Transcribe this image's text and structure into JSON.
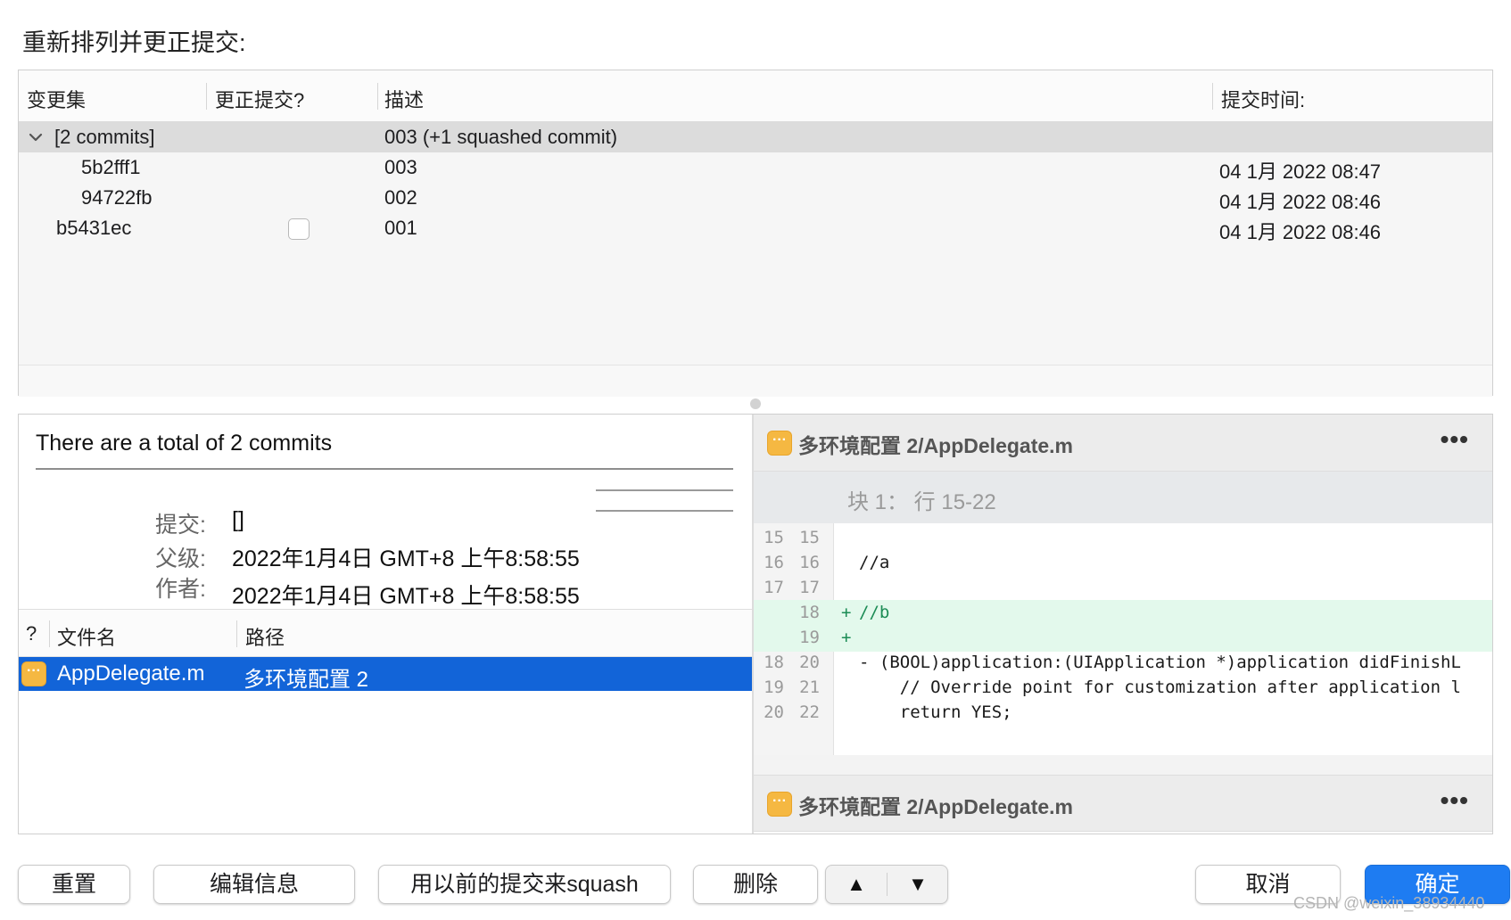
{
  "dialog": {
    "title": "重新排列并更正提交:"
  },
  "commit_table": {
    "columns": [
      "变更集",
      "更正提交?",
      "描述",
      "提交时间:"
    ],
    "group": {
      "label": "[2 commits]",
      "description": "003 (+1 squashed commit)"
    },
    "rows": [
      {
        "changeset": "5b2fff1",
        "description": "003",
        "time": "04 1月 2022 08:47"
      },
      {
        "changeset": "94722fb",
        "description": "002",
        "time": "04 1月 2022 08:46"
      },
      {
        "changeset": "b5431ec",
        "description": "001",
        "time": "04 1月 2022 08:46",
        "fixup_checked": false
      }
    ]
  },
  "commit_info": {
    "message": "There are a total of 2 commits",
    "meta": [
      {
        "label": "提交:",
        "value": "[]"
      },
      {
        "label": "父级:",
        "value": "2022年1月4日 GMT+8 上午8:58:55"
      },
      {
        "label": "作者:",
        "value": "2022年1月4日 GMT+8 上午8:58:55"
      }
    ]
  },
  "files": {
    "columns": [
      "?",
      "文件名",
      "路径"
    ],
    "rows": [
      {
        "name": "AppDelegate.m",
        "path": "多环境配置 2",
        "status_icon": "modified-file-icon",
        "selected": true
      }
    ]
  },
  "diff": {
    "file_path": "多环境配置 2/AppDelegate.m",
    "more_label": "•••",
    "hunk_title": "块 1： 行 15-22",
    "lines": [
      {
        "old": "15",
        "new": "15",
        "marker": "",
        "text": "",
        "type": "ctx"
      },
      {
        "old": "16",
        "new": "16",
        "marker": "",
        "text": "//a",
        "type": "ctx"
      },
      {
        "old": "17",
        "new": "17",
        "marker": "",
        "text": "",
        "type": "ctx"
      },
      {
        "old": "",
        "new": "18",
        "marker": "+",
        "text": "//b",
        "type": "add"
      },
      {
        "old": "",
        "new": "19",
        "marker": "+",
        "text": "",
        "type": "add"
      },
      {
        "old": "18",
        "new": "20",
        "marker": "",
        "text": "- (BOOL)application:(UIApplication *)application didFinishL",
        "type": "ctx"
      },
      {
        "old": "19",
        "new": "21",
        "marker": "",
        "text": "    // Override point for customization after application l",
        "type": "ctx"
      },
      {
        "old": "20",
        "new": "22",
        "marker": "",
        "text": "    return YES;",
        "type": "ctx"
      }
    ],
    "next_file_path": "多环境配置 2/AppDelegate.m"
  },
  "buttons": {
    "reset": "重置",
    "edit_message": "编辑信息",
    "squash": "用以前的提交来squash",
    "delete": "删除",
    "move_up": "▲",
    "move_down": "▼",
    "cancel": "取消",
    "ok": "确定"
  },
  "watermark": "CSDN @weixin_38934440",
  "colors": {
    "accent": "#1264d8",
    "primary_button": "#1e7cf2",
    "file_icon": "#f5b842",
    "added_line_bg": "#e3f9ec"
  }
}
